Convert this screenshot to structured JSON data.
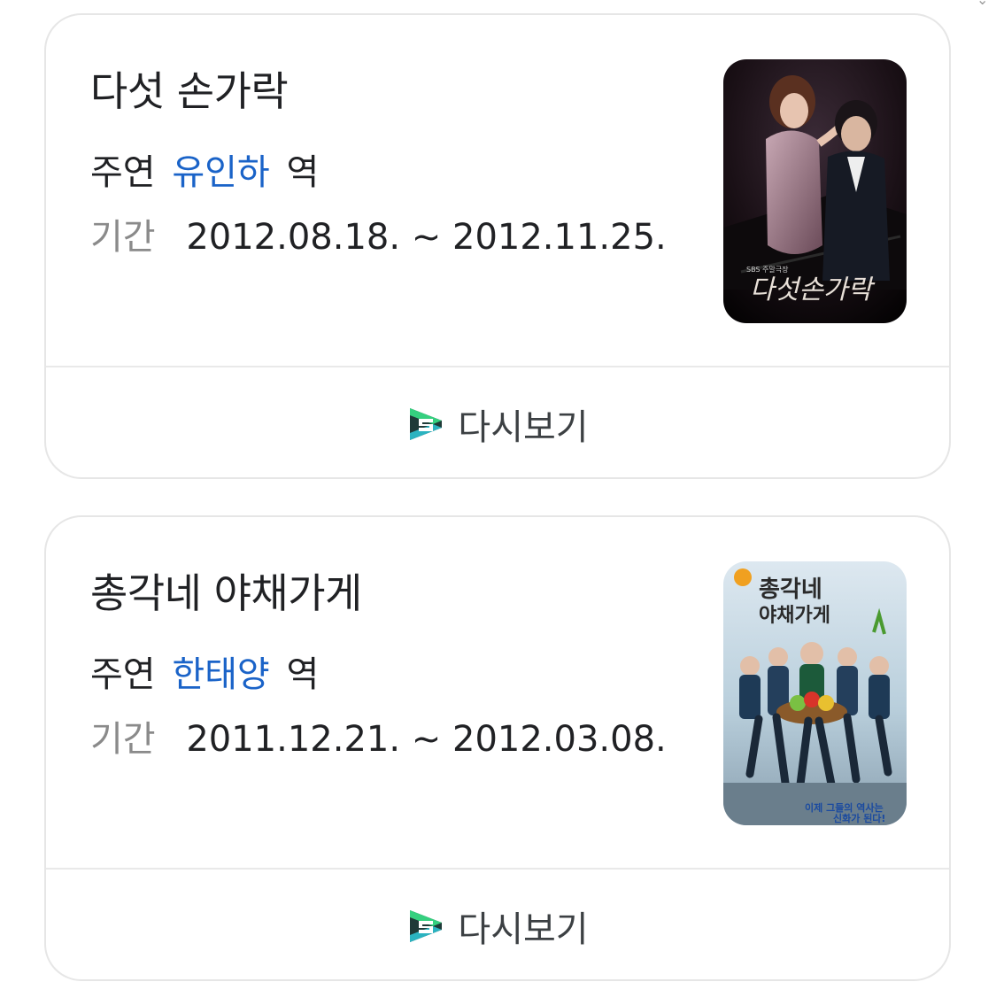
{
  "cards": [
    {
      "title": "다섯 손가락",
      "role_prefix": "주연",
      "actor": "유인하",
      "role_suffix": "역",
      "period_label": "기간",
      "period_value": "2012.08.18. ~ 2012.11.25.",
      "poster_icon": "drama-poster-five-fingers",
      "rewatch_label": "다시보기",
      "rewatch_icon": "sbs-s-icon"
    },
    {
      "title": "총각네 야채가게",
      "role_prefix": "주연",
      "actor": "한태양",
      "role_suffix": "역",
      "period_label": "기간",
      "period_value": "2011.12.21. ~ 2012.03.08.",
      "poster_icon": "drama-poster-vegetable-store",
      "rewatch_label": "다시보기",
      "rewatch_icon": "sbs-s-icon"
    }
  ],
  "colors": {
    "actor_link": "#1a63c8",
    "text_primary": "#202124",
    "text_secondary": "#8a8a8a",
    "card_border": "#e6e6e6"
  }
}
